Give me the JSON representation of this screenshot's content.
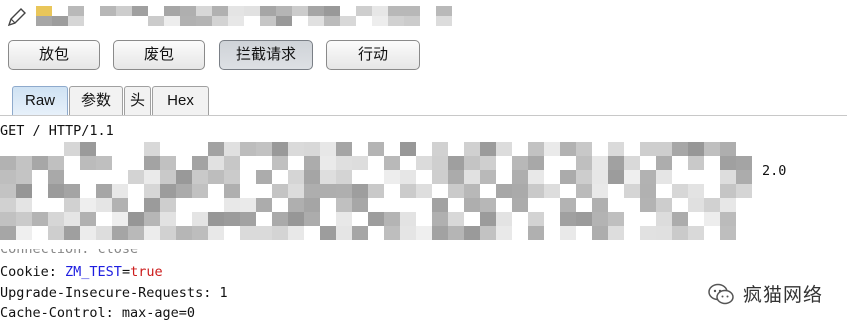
{
  "toolbar": {
    "forward_label": "放包",
    "drop_label": "废包",
    "intercept_label": "拦截请求",
    "action_label": "行动"
  },
  "tabs": [
    {
      "label": "Raw",
      "active": true
    },
    {
      "label": "参数",
      "active": false
    },
    {
      "label": "头",
      "active": false
    },
    {
      "label": "Hex",
      "active": false
    }
  ],
  "request": {
    "request_line": "GET / HTTP/1.1",
    "partial_suffix": "2.0",
    "connection_partial": "Connection: close",
    "cookie_name": "Cookie: ",
    "cookie_key": "ZM_TEST",
    "cookie_eq": "=",
    "cookie_value": "true",
    "upgrade": "Upgrade-Insecure-Requests: 1",
    "cache": "Cache-Control: max-age=0"
  },
  "watermark": {
    "text": "疯猫网络",
    "icon": "wechat-icon"
  },
  "icons": {
    "edit": "pencil-icon"
  },
  "colors": {
    "cookie_key": "#1d1de0",
    "cookie_value": "#cc1b1b",
    "active_tab": "#cfe2f3"
  }
}
